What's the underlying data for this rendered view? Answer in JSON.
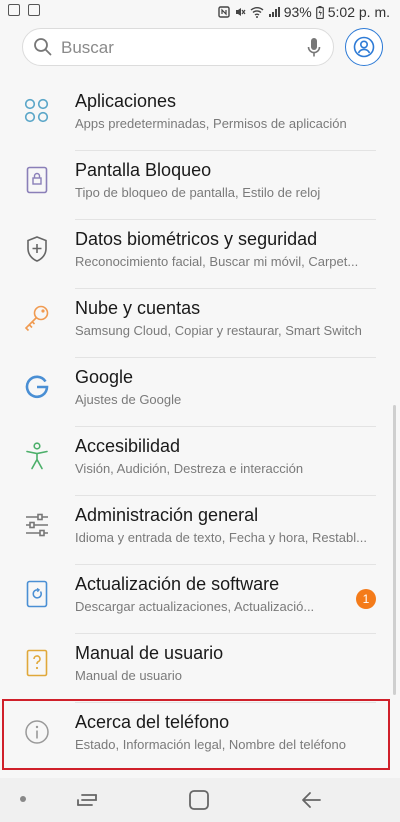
{
  "status_bar": {
    "battery": "93%",
    "time": "5:02 p. m."
  },
  "search": {
    "placeholder": "Buscar"
  },
  "items": [
    {
      "icon": "apps-icon",
      "title": "Aplicaciones",
      "subtitle": "Apps predeterminadas, Permisos de aplicación"
    },
    {
      "icon": "lock-screen-icon",
      "title": "Pantalla Bloqueo",
      "subtitle": "Tipo de bloqueo de pantalla, Estilo de reloj"
    },
    {
      "icon": "shield-icon",
      "title": "Datos biométricos y seguridad",
      "subtitle": "Reconocimiento facial, Buscar mi móvil, Carpet..."
    },
    {
      "icon": "key-icon",
      "title": "Nube y cuentas",
      "subtitle": "Samsung Cloud, Copiar y restaurar, Smart Switch"
    },
    {
      "icon": "google-icon",
      "title": "Google",
      "subtitle": "Ajustes de Google"
    },
    {
      "icon": "accessibility-icon",
      "title": "Accesibilidad",
      "subtitle": "Visión, Audición, Destreza e interacción"
    },
    {
      "icon": "sliders-icon",
      "title": "Administración general",
      "subtitle": "Idioma y entrada de texto, Fecha y hora, Restabl..."
    },
    {
      "icon": "software-update-icon",
      "title": "Actualización de software",
      "subtitle": "Descargar actualizaciones, Actualizació...",
      "badge": "1"
    },
    {
      "icon": "manual-icon",
      "title": "Manual de usuario",
      "subtitle": "Manual de usuario"
    },
    {
      "icon": "info-icon",
      "title": "Acerca del teléfono",
      "subtitle": "Estado, Información legal, Nombre del teléfono"
    }
  ],
  "colors": {
    "accent": "#2e7bd6",
    "badge": "#f47b1a",
    "highlight": "#d0202a"
  }
}
